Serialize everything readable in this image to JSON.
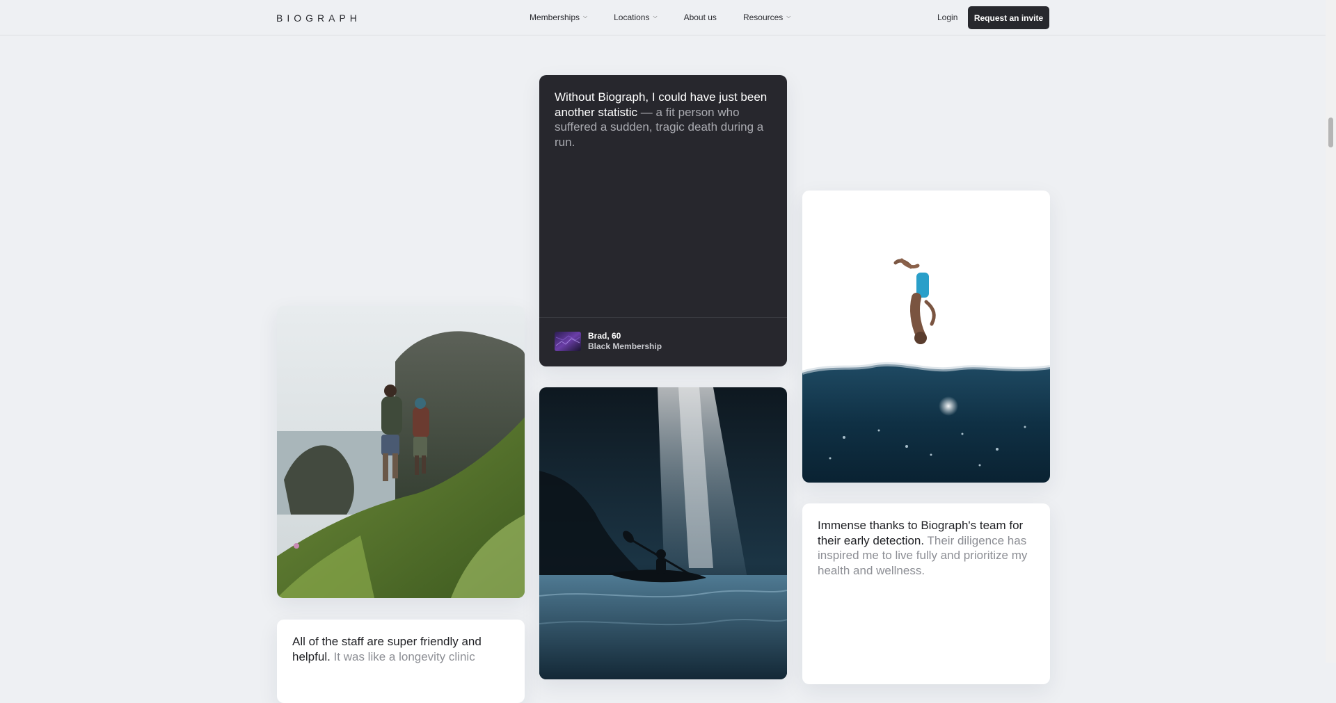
{
  "header": {
    "logo": "BIOGRAPH",
    "nav": [
      {
        "label": "Memberships",
        "has_dropdown": true
      },
      {
        "label": "Locations",
        "has_dropdown": true
      },
      {
        "label": "About us",
        "has_dropdown": false
      },
      {
        "label": "Resources",
        "has_dropdown": true
      }
    ],
    "login_label": "Login",
    "cta_label": "Request an invite"
  },
  "testimonials": {
    "brad": {
      "strong": "Without Biograph, I could have just been another statistic",
      "soft": " — a fit person who suffered a sudden, tragic death during a run.",
      "author_name": "Brad, 60",
      "author_tier": "Black Membership"
    },
    "thanks": {
      "strong": "Immense thanks to Biograph's team for their early detection.",
      "soft": " Their diligence has inspired me to live fully and prioritize my health and wellness."
    },
    "staff": {
      "strong": "All of the staff are super friendly and helpful.",
      "soft": " It was like a longevity clinic"
    }
  },
  "images": {
    "hikers": "hikers-on-cliff-photo",
    "kayak": "kayak-waterfall-cave-photo",
    "diver": "cliff-diver-over-sea-photo"
  },
  "colors": {
    "background": "#eef0f3",
    "dark_card": "#27272d",
    "cta": "#27282d"
  }
}
